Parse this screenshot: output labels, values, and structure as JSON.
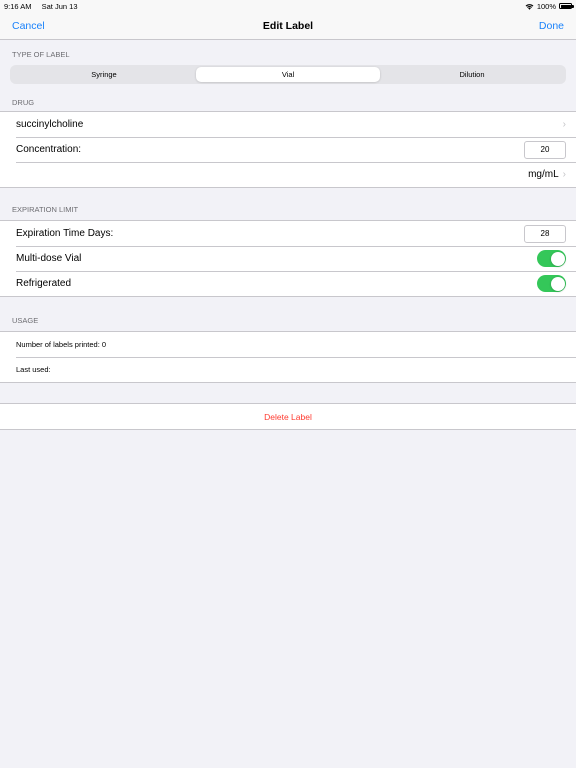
{
  "status": {
    "time": "9:16 AM",
    "date": "Sat Jun 13",
    "battery": "100%"
  },
  "nav": {
    "cancel": "Cancel",
    "title": "Edit Label",
    "done": "Done"
  },
  "type_section": {
    "header": "TYPE OF LABEL",
    "options": [
      "Syringe",
      "Vial",
      "Dilution"
    ],
    "selected": "Vial"
  },
  "drug_section": {
    "header": "DRUG",
    "drug_name": "succinylcholine",
    "concentration_label": "Concentration:",
    "concentration_value": "20",
    "unit": "mg/mL"
  },
  "expiration_section": {
    "header": "EXPIRATION LIMIT",
    "days_label": "Expiration Time Days:",
    "days_value": "28",
    "multidose_label": "Multi-dose Vial",
    "multidose_on": true,
    "refrigerated_label": "Refrigerated",
    "refrigerated_on": true
  },
  "usage_section": {
    "header": "USAGE",
    "printed": "Number of labels printed: 0",
    "last_used": "Last used:"
  },
  "delete_label": "Delete Label",
  "colors": {
    "accent": "#1a82fb",
    "toggle_on": "#34c759",
    "destructive": "#ff3b30"
  }
}
